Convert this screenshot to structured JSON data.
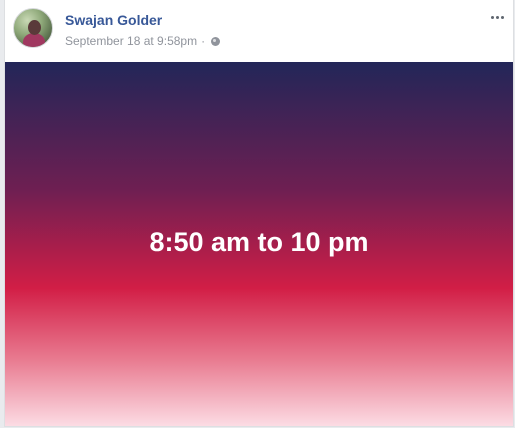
{
  "post": {
    "author": "Swajan Golder",
    "timestamp": "September 18 at 9:58pm",
    "separator": "·",
    "privacy_icon": "globe-icon",
    "more_icon": "more-horizontal-icon",
    "status_text": "8:50 am to 10 pm",
    "colors": {
      "author_link": "#385898",
      "meta_text": "#90949c",
      "gradient_top": "#222658",
      "gradient_mid": "#d21e46",
      "gradient_bottom": "#fcdde5"
    }
  }
}
